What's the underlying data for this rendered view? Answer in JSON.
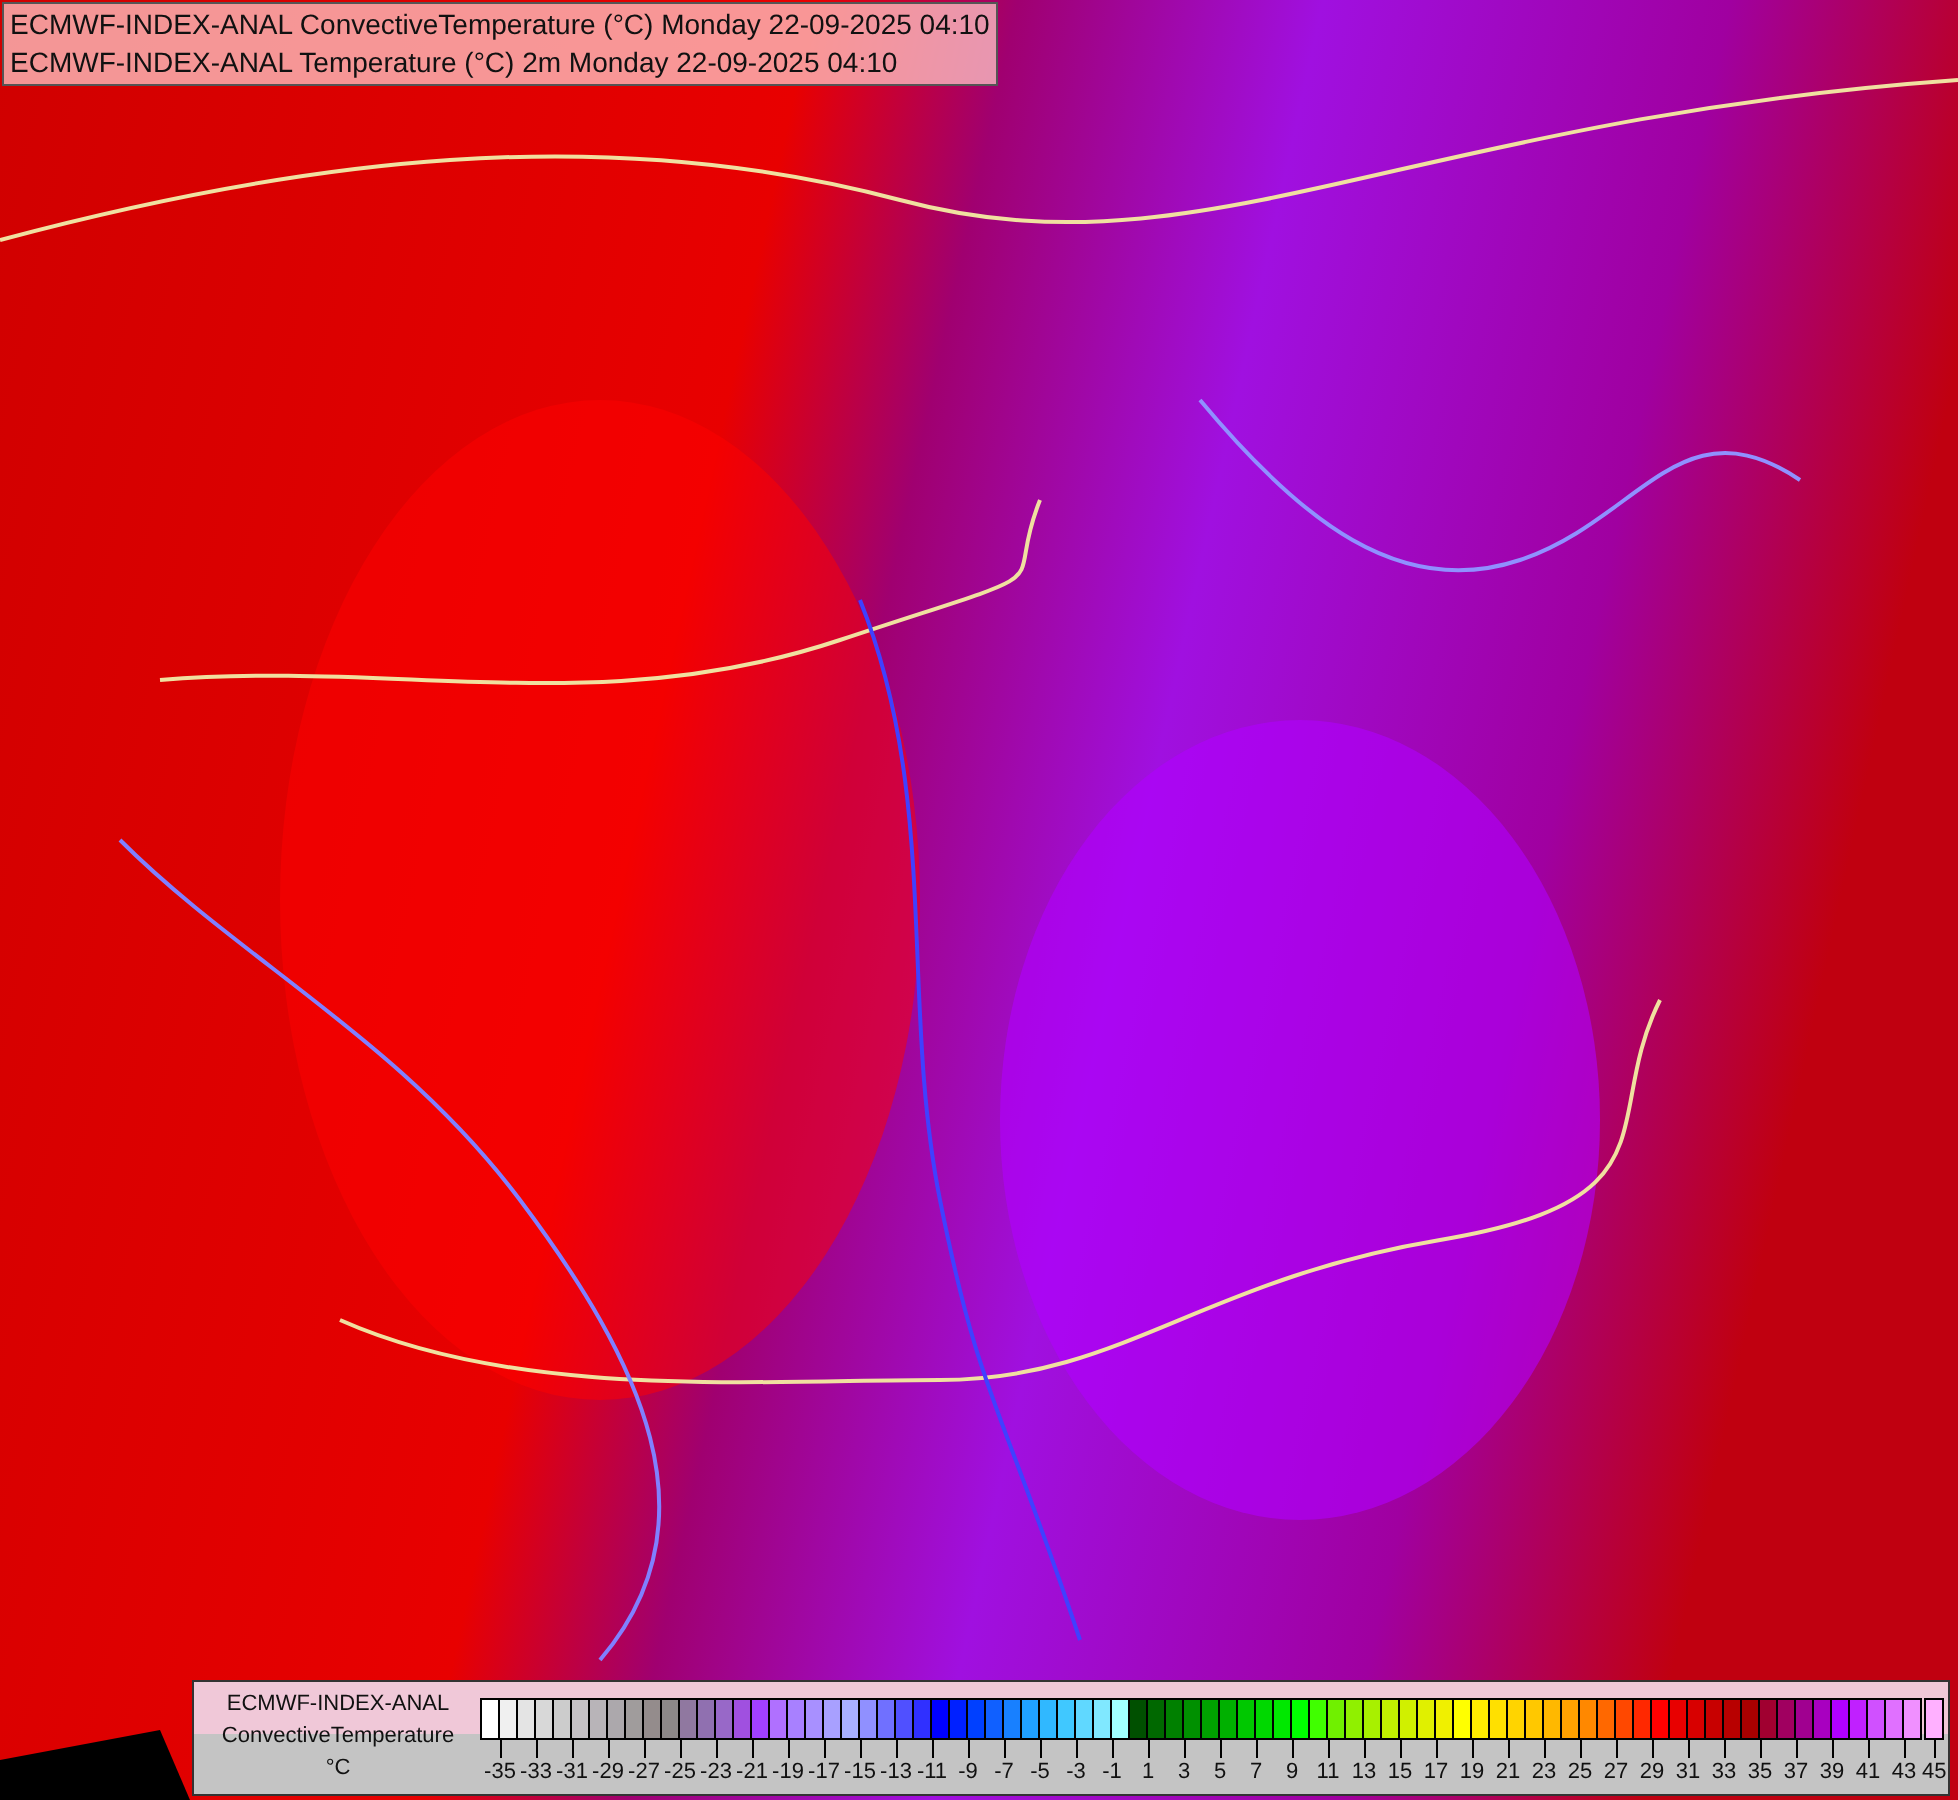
{
  "titles": [
    "ECMWF-INDEX-ANAL ConvectiveTemperature (°C) Monday 22-09-2025 04:10",
    "ECMWF-INDEX-ANAL Temperature (°C) 2m Monday 22-09-2025 04:10"
  ],
  "legend": {
    "model": "ECMWF-INDEX-ANAL",
    "parameter": "ConvectiveTemperature",
    "unit": "°C",
    "scale": [
      {
        "label": "-35",
        "swatches": [
          {
            "color": "#ffffff"
          },
          {
            "color": "#f0f0f0"
          }
        ]
      },
      {
        "label": "-33",
        "swatches": [
          {
            "color": "#e4e4e4"
          },
          {
            "color": "#d8d8d8"
          }
        ]
      },
      {
        "label": "-31",
        "swatches": [
          {
            "color": "#cccccc"
          },
          {
            "color": "#c4c0c4"
          }
        ]
      },
      {
        "label": "-29",
        "swatches": [
          {
            "color": "#b8b4b8"
          },
          {
            "color": "#aca8ac"
          }
        ]
      },
      {
        "label": "-27",
        "swatches": [
          {
            "color": "#a09c9c"
          },
          {
            "color": "#948c8c"
          }
        ]
      },
      {
        "label": "-25",
        "swatches": [
          {
            "color": "#8c8888"
          },
          {
            "color": "#9078a0"
          }
        ]
      },
      {
        "label": "-23",
        "swatches": [
          {
            "color": "#9070b0"
          },
          {
            "color": "#9868c8"
          }
        ]
      },
      {
        "label": "-21",
        "swatches": [
          {
            "color": "#a050e0"
          },
          {
            "color": "#a040ff"
          }
        ]
      },
      {
        "label": "-19",
        "swatches": [
          {
            "color": "#b070ff"
          },
          {
            "color": "#a880ff"
          }
        ]
      },
      {
        "label": "-17",
        "swatches": [
          {
            "color": "#a890ff"
          },
          {
            "color": "#a8a0ff"
          }
        ]
      },
      {
        "label": "-15",
        "swatches": [
          {
            "color": "#a8b0ff"
          },
          {
            "color": "#9090ff"
          }
        ]
      },
      {
        "label": "-13",
        "swatches": [
          {
            "color": "#7070ff"
          },
          {
            "color": "#5050ff"
          }
        ]
      },
      {
        "label": "-11",
        "swatches": [
          {
            "color": "#3030ff"
          },
          {
            "color": "#0000ff"
          }
        ]
      },
      {
        "label": "-9",
        "swatches": [
          {
            "color": "#0020ff"
          },
          {
            "color": "#0040ff"
          }
        ]
      },
      {
        "label": "-7",
        "swatches": [
          {
            "color": "#1060ff"
          },
          {
            "color": "#1880ff"
          }
        ]
      },
      {
        "label": "-5",
        "swatches": [
          {
            "color": "#20a0ff"
          },
          {
            "color": "#30b8ff"
          }
        ]
      },
      {
        "label": "-3",
        "swatches": [
          {
            "color": "#40c8ff"
          },
          {
            "color": "#60d8ff"
          }
        ]
      },
      {
        "label": "-1",
        "swatches": [
          {
            "color": "#80e8ff"
          },
          {
            "color": "#a0ffff"
          }
        ]
      },
      {
        "label": "1",
        "swatches": [
          {
            "color": "#005000"
          },
          {
            "color": "#006800"
          }
        ]
      },
      {
        "label": "3",
        "swatches": [
          {
            "color": "#008000"
          },
          {
            "color": "#009000"
          }
        ]
      },
      {
        "label": "5",
        "swatches": [
          {
            "color": "#00a000"
          },
          {
            "color": "#00b000"
          }
        ]
      },
      {
        "label": "7",
        "swatches": [
          {
            "color": "#00c800"
          },
          {
            "color": "#00d800"
          }
        ]
      },
      {
        "label": "9",
        "swatches": [
          {
            "color": "#00e800"
          },
          {
            "color": "#00ff00"
          }
        ]
      },
      {
        "label": "11",
        "swatches": [
          {
            "color": "#40ff00"
          },
          {
            "color": "#70f000"
          }
        ]
      },
      {
        "label": "13",
        "swatches": [
          {
            "color": "#90f000"
          },
          {
            "color": "#a8f000"
          }
        ]
      },
      {
        "label": "15",
        "swatches": [
          {
            "color": "#c0f000"
          },
          {
            "color": "#d0f000"
          }
        ]
      },
      {
        "label": "17",
        "swatches": [
          {
            "color": "#e0f000"
          },
          {
            "color": "#f0f000"
          }
        ]
      },
      {
        "label": "19",
        "swatches": [
          {
            "color": "#ffff00"
          },
          {
            "color": "#ffec00"
          }
        ]
      },
      {
        "label": "21",
        "swatches": [
          {
            "color": "#ffe000"
          },
          {
            "color": "#ffd400"
          }
        ]
      },
      {
        "label": "23",
        "swatches": [
          {
            "color": "#ffc800"
          },
          {
            "color": "#ffb800"
          }
        ]
      },
      {
        "label": "25",
        "swatches": [
          {
            "color": "#ffa000"
          },
          {
            "color": "#ff8800"
          }
        ]
      },
      {
        "label": "27",
        "swatches": [
          {
            "color": "#ff6800"
          },
          {
            "color": "#ff4800"
          }
        ]
      },
      {
        "label": "29",
        "swatches": [
          {
            "color": "#ff2800"
          },
          {
            "color": "#ff0000"
          }
        ]
      },
      {
        "label": "31",
        "swatches": [
          {
            "color": "#e80000"
          },
          {
            "color": "#d80000"
          }
        ]
      },
      {
        "label": "33",
        "swatches": [
          {
            "color": "#c80000"
          },
          {
            "color": "#b80000"
          }
        ]
      },
      {
        "label": "35",
        "swatches": [
          {
            "color": "#a80000"
          },
          {
            "color": "#a00030"
          }
        ]
      },
      {
        "label": "37",
        "swatches": [
          {
            "color": "#a00060"
          },
          {
            "color": "#a00090"
          }
        ]
      },
      {
        "label": "39",
        "swatches": [
          {
            "color": "#a800c0"
          },
          {
            "color": "#b000ff"
          }
        ]
      },
      {
        "label": "41",
        "swatches": [
          {
            "color": "#c020ff"
          },
          {
            "color": "#d050ff"
          }
        ]
      },
      {
        "label": "43",
        "swatches": [
          {
            "color": "#e070ff"
          },
          {
            "color": "#f090ff"
          }
        ]
      },
      {
        "label": "45",
        "swatches": [
          {
            "color": "#ffb0ff"
          }
        ]
      }
    ]
  }
}
